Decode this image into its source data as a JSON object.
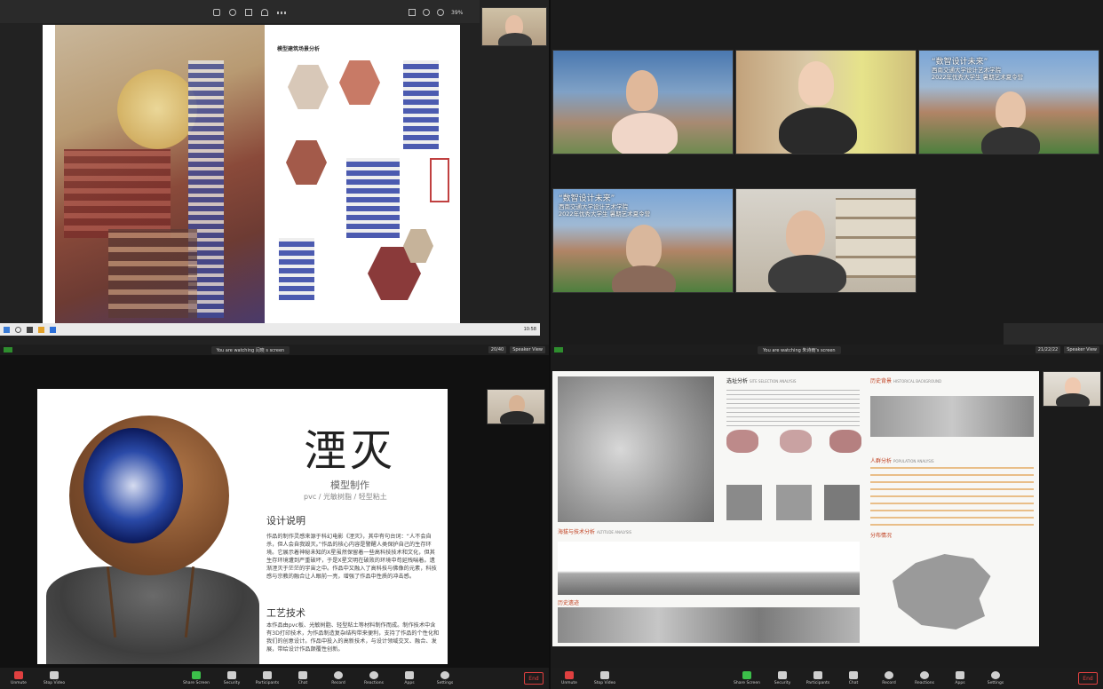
{
  "q1": {
    "toolbar": {
      "zoom": "39%"
    },
    "panel_title": "模型建筑场景分析",
    "taskbar_time": "10:58",
    "bottom_left": "",
    "bottom_right_box": "45/40"
  },
  "q2": {
    "video_caption_1": "“数智设计未来”",
    "video_caption_2": "西南交通大学设计艺术学院",
    "video_caption_3": "2022年优秀大学生 暑期艺术夏令营",
    "video2_caption_1": "“数智设计未来”",
    "video2_caption_2": "西南交通大学设计艺术学院",
    "video2_caption_3": "2022年优秀大学生 暑期艺术夏令营"
  },
  "q3": {
    "watch_text": "You are watching 闫晓 s screen",
    "watch_right_box": "20/40",
    "speaker_view": "Speaker View",
    "title": "湮灭",
    "subtitle": "模型制作",
    "material": "pvc / 光敏树脂 / 轻型粘土",
    "section1_heading": "设计说明",
    "section1_body": "作品的制作灵感来源于科幻电影《湮灭》，其中有句台词：“人不会自杀，但人会自我毁灭。”作品的核心内容是警醒人类保护自己的生存环境。它展示着神秘未知的X星虽然保留着一些高科技技术和文化，但其生存环境遭到严重破坏，于是X星文明在破败的环境中苟延残喘着。遗渐湮灭于茫茫的宇宙之中。作品中又融入了高科技与佛像的元素，科技感与宗教的融合让人眼前一亮，增强了作品中性质的冲击感。",
    "section2_heading": "工艺技术",
    "section2_body": "本作品由pvc板、光敏树脂、轻型粘土等材料制作而成。制作技术中含有3D打印技术，为作品制造复杂结构带来便利，支持了作品的个性化和我们的创意设计。作品中投入的高新技术，与设计领域交叉、融合、发展，带给设计作品颠覆性创新。",
    "controls": [
      {
        "label": "Unmute"
      },
      {
        "label": "Stop Video"
      },
      {
        "label": "Share Screen"
      },
      {
        "label": "Security"
      },
      {
        "label": "Participants"
      },
      {
        "label": "Chat"
      },
      {
        "label": "Record"
      },
      {
        "label": "Reactions"
      },
      {
        "label": "Apps"
      },
      {
        "label": "Settings"
      }
    ],
    "end_label": "End"
  },
  "q4": {
    "watch_text": "You are watching 朱诗雨's screen",
    "watch_right_box": "21/22/22",
    "speaker_view": "Speaker View",
    "heading_site": "选址分析",
    "heading_site_en": "SITE SELECTION ANALYSIS",
    "heading_history": "历史背景",
    "heading_history_en": "HISTORICAL BACKGROUND",
    "heading_people": "人群分析",
    "heading_people_en": "POPULATION ANALYSIS",
    "heading_terrain": "海拔与技术分析",
    "heading_terrain_en": "ALTITUDE ANALYSIS",
    "heading_landscape": "历史遗迹",
    "heading_distribution": "分布情况",
    "controls": [
      {
        "label": "Unmute"
      },
      {
        "label": "Stop Video"
      },
      {
        "label": "Share Screen"
      },
      {
        "label": "Security"
      },
      {
        "label": "Participants"
      },
      {
        "label": "Chat"
      },
      {
        "label": "Record"
      },
      {
        "label": "Reactions"
      },
      {
        "label": "Apps"
      },
      {
        "label": "Settings"
      }
    ],
    "end_label": "End"
  },
  "colors": {
    "end": "#e04040",
    "bg": "#0e0e0e",
    "slide": "#ffffff"
  }
}
